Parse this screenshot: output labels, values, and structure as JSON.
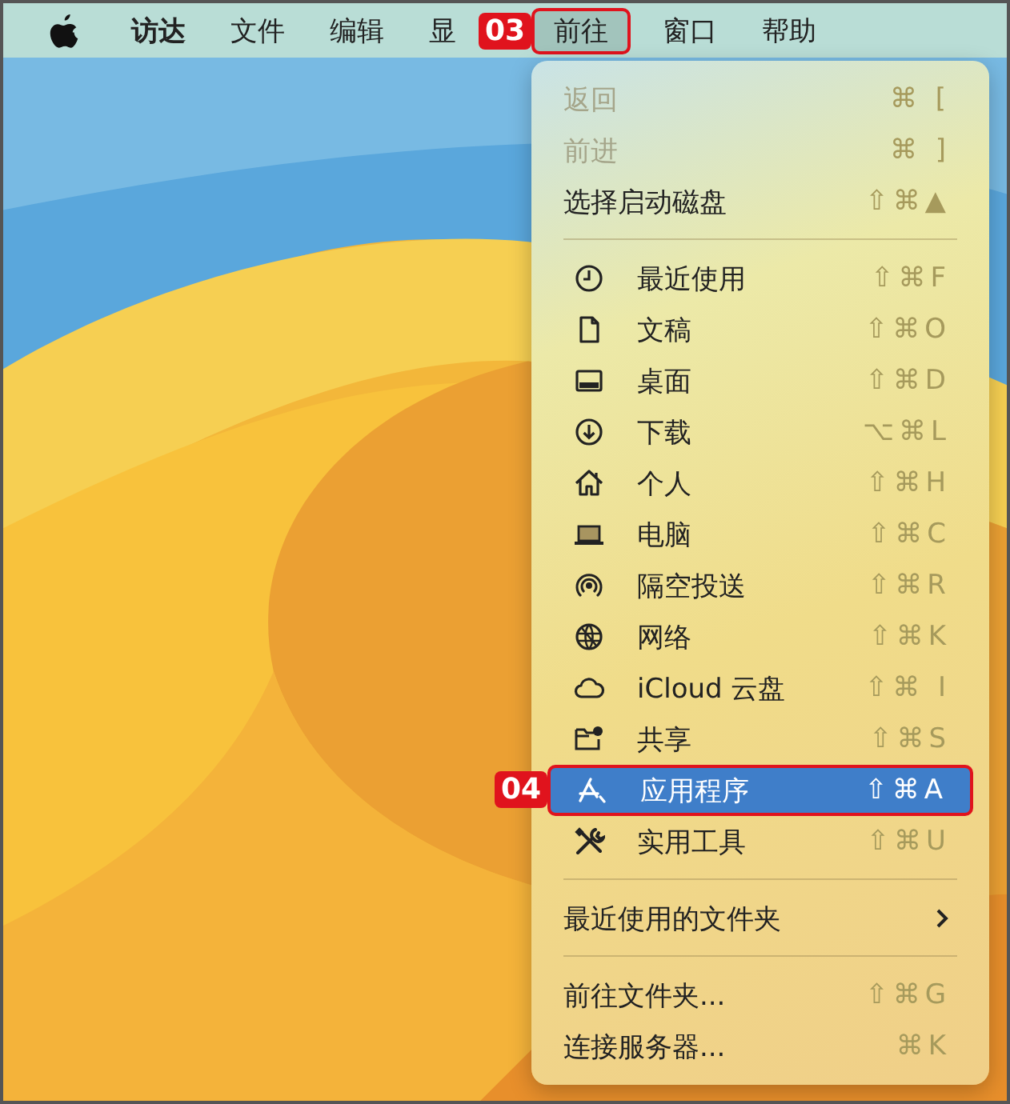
{
  "menu_bar": {
    "items": [
      {
        "label": "访达",
        "kind": "app",
        "selected": false
      },
      {
        "label": "文件",
        "kind": "menu",
        "selected": false
      },
      {
        "label": "编辑",
        "kind": "menu",
        "selected": false
      },
      {
        "label": "显",
        "kind": "menu",
        "selected": false
      },
      {
        "label": "前往",
        "kind": "menu",
        "selected": true,
        "callout": "03"
      },
      {
        "label": "窗口",
        "kind": "menu",
        "selected": false
      },
      {
        "label": "帮助",
        "kind": "menu",
        "selected": false
      }
    ]
  },
  "go_menu": {
    "sections": [
      {
        "items": [
          {
            "label": "返回",
            "kind": "plain",
            "shortcut": "⌘ [",
            "disabled": true,
            "selected": false
          },
          {
            "label": "前进",
            "kind": "plain",
            "shortcut": "⌘ ]",
            "disabled": true,
            "selected": false
          },
          {
            "label": "选择启动磁盘",
            "kind": "plain",
            "shortcut": "⇧⌘▲",
            "disabled": false,
            "selected": false
          }
        ]
      },
      {
        "items": [
          {
            "label": "最近使用",
            "kind": "icon",
            "shortcut": "⇧⌘F",
            "disabled": false,
            "selected": false
          },
          {
            "label": "文稿",
            "kind": "icon",
            "shortcut": "⇧⌘O",
            "disabled": false,
            "selected": false
          },
          {
            "label": "桌面",
            "kind": "icon",
            "shortcut": "⇧⌘D",
            "disabled": false,
            "selected": false
          },
          {
            "label": "下载",
            "kind": "icon",
            "shortcut": "⌥⌘L",
            "disabled": false,
            "selected": false
          },
          {
            "label": "个人",
            "kind": "icon",
            "shortcut": "⇧⌘H",
            "disabled": false,
            "selected": false
          },
          {
            "label": "电脑",
            "kind": "icon",
            "shortcut": "⇧⌘C",
            "disabled": false,
            "selected": false
          },
          {
            "label": "隔空投送",
            "kind": "icon",
            "shortcut": "⇧⌘R",
            "disabled": false,
            "selected": false
          },
          {
            "label": "网络",
            "kind": "icon",
            "shortcut": "⇧⌘K",
            "disabled": false,
            "selected": false
          },
          {
            "label": "iCloud 云盘",
            "kind": "icon",
            "shortcut": "⇧⌘ I",
            "disabled": false,
            "selected": false
          },
          {
            "label": "共享",
            "kind": "icon",
            "shortcut": "⇧⌘S",
            "disabled": false,
            "selected": false
          },
          {
            "label": "应用程序",
            "kind": "icon",
            "shortcut": "⇧⌘A",
            "disabled": false,
            "selected": true,
            "callout": "04"
          },
          {
            "label": "实用工具",
            "kind": "icon",
            "shortcut": "⇧⌘U",
            "disabled": false,
            "selected": false
          }
        ]
      },
      {
        "items": [
          {
            "label": "最近使用的文件夹",
            "kind": "submenu",
            "disabled": false,
            "selected": false
          }
        ]
      },
      {
        "items": [
          {
            "label": "前往文件夹...",
            "kind": "plain",
            "shortcut": "⇧⌘G",
            "disabled": false,
            "selected": false
          },
          {
            "label": "连接服务器...",
            "kind": "plain",
            "shortcut": "⌘K",
            "disabled": false,
            "selected": false
          }
        ]
      }
    ]
  }
}
